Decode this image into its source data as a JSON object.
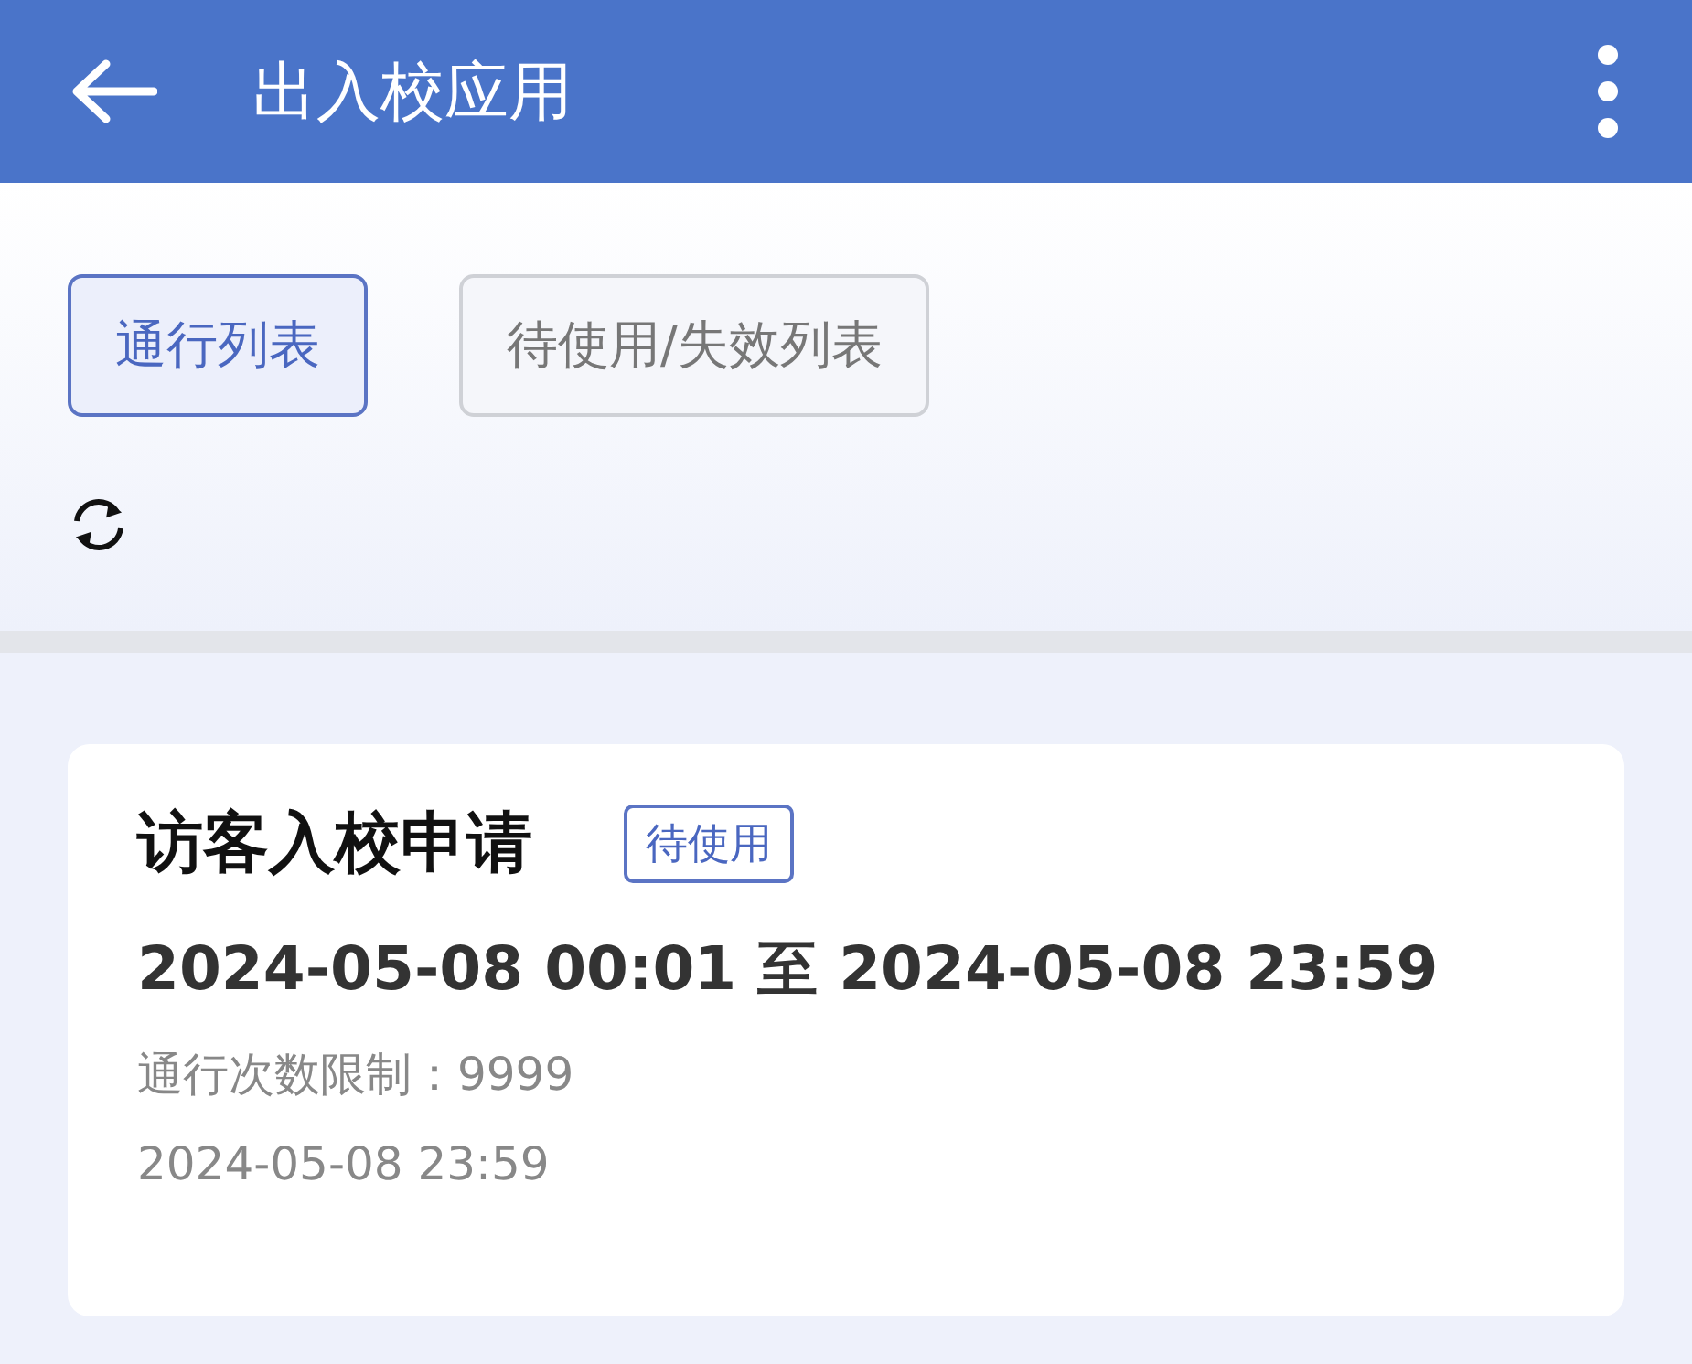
{
  "header": {
    "title": "出入校应用"
  },
  "tabs": [
    {
      "label": "通行列表",
      "selected": true
    },
    {
      "label": "待使用/失效列表",
      "selected": false
    }
  ],
  "records": [
    {
      "title": "访客入校申请",
      "status": "待使用",
      "period": "2024-05-08 00:01 至 2024-05-08 23:59",
      "limit": "通行次数限制：9999",
      "time": "2024-05-08 23:59"
    }
  ]
}
